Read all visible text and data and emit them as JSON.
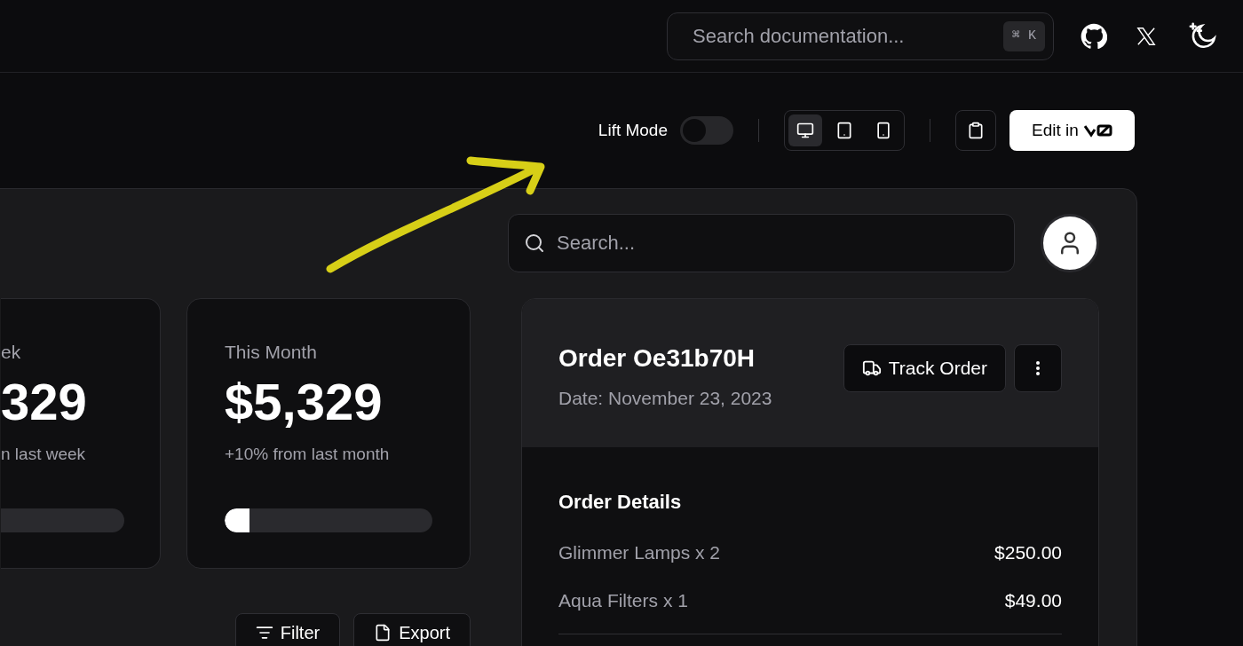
{
  "header": {
    "search": {
      "placeholder": "Search documentation...",
      "shortcut": "⌘ K"
    }
  },
  "toolbar": {
    "lift_mode": {
      "label": "Lift Mode",
      "on": false
    },
    "devices": [
      {
        "kind": "desktop",
        "selected": true
      },
      {
        "kind": "tablet",
        "selected": false
      },
      {
        "kind": "phone",
        "selected": false
      }
    ],
    "edit_button": "Edit in"
  },
  "preview": {
    "search": {
      "placeholder": "Search..."
    },
    "stats": [
      {
        "title": "ek",
        "value": "329",
        "change": "n last week",
        "cut": true
      },
      {
        "title": "This Month",
        "value": "$5,329",
        "change": "+10% from last month",
        "cut": false,
        "level": 0.12
      }
    ],
    "actions": [
      {
        "kind": "filter",
        "label": "Filter"
      },
      {
        "kind": "export",
        "label": "Export"
      }
    ],
    "order": {
      "title": "Order Oe31b70H",
      "date": "Date: November 23, 2023",
      "track_button": "Track Order",
      "details_title": "Order Details",
      "items": [
        {
          "name": "Glimmer Lamps x 2",
          "price": "$250.00"
        },
        {
          "name": "Aqua Filters x 1",
          "price": "$49.00"
        }
      ]
    }
  }
}
